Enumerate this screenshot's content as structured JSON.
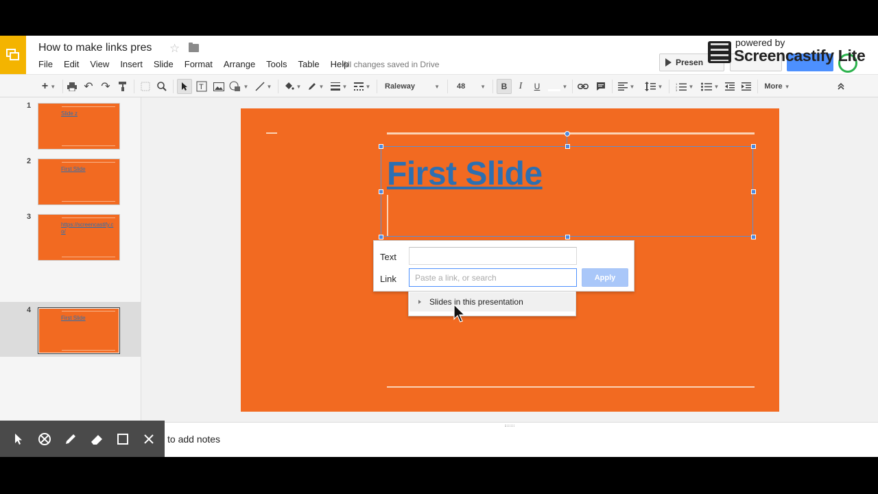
{
  "header": {
    "doc_title": "How to make links pres",
    "present_label": "Presen",
    "save_status": "All changes saved in Drive"
  },
  "watermark": {
    "small": "powered by",
    "big": "Screencastify Lite"
  },
  "menus": [
    "File",
    "Edit",
    "View",
    "Insert",
    "Slide",
    "Format",
    "Arrange",
    "Tools",
    "Table",
    "Help"
  ],
  "toolbar": {
    "font_family": "Raleway",
    "font_size": "48",
    "bold": "B",
    "italic": "I",
    "underline": "U",
    "more": "More"
  },
  "slides": [
    {
      "number": "1",
      "title": "Slide z"
    },
    {
      "number": "2",
      "title": "First Slide"
    },
    {
      "number": "3",
      "title": "https://screencastify.co/"
    },
    {
      "number": "4",
      "title": "First Slide"
    }
  ],
  "canvas": {
    "title": "First Slide"
  },
  "link_dialog": {
    "text_label": "Text",
    "link_label": "Link",
    "text_value": "",
    "link_placeholder": "Paste a link, or search",
    "apply_label": "Apply",
    "suggestion": "Slides in this presentation"
  },
  "notes": {
    "placeholder": "to add notes"
  },
  "colors": {
    "slide_bg": "#f26a21",
    "title_link": "#2d6fb1",
    "selection": "#4d8ae0",
    "logo": "#f4b400"
  }
}
